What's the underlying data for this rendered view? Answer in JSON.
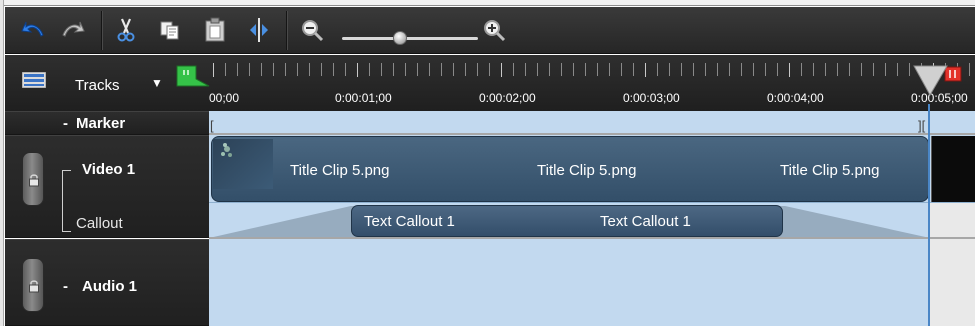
{
  "toolbar": {
    "undo": "undo-icon",
    "redo": "redo-icon",
    "cut": "scissors-icon",
    "copy": "copy-icon",
    "paste": "paste-icon",
    "split": "split-icon",
    "zoom_out": "zoom-out-icon",
    "zoom_in": "zoom-in-icon",
    "zoom_level": 0.45
  },
  "header": {
    "tracks_label": "Tracks",
    "dropdown_icon": "chevron-down-icon"
  },
  "ruler": {
    "times": [
      "00;00",
      "0:00:01;00",
      "0:00:02;00",
      "0:00:03;00",
      "0:00:04;00",
      "0:00:05;00"
    ]
  },
  "tracks": {
    "marker": {
      "label": "Marker",
      "collapse_symbol": "-"
    },
    "video": {
      "label": "Video 1",
      "sublabel": "Callout"
    },
    "audio": {
      "label": "Audio 1",
      "collapse_symbol": "-"
    }
  },
  "clips": {
    "video_titles": [
      "Title Clip 5.png",
      "Title Clip 5.png",
      "Title Clip 5.png"
    ],
    "callouts": [
      "Text Callout 1",
      "Text Callout 1"
    ]
  },
  "colors": {
    "lane_blue": "#c2d9ef",
    "clip_blue": "#3a566f",
    "marker_green": "#35c248",
    "playhead_red": "#e3312a"
  }
}
